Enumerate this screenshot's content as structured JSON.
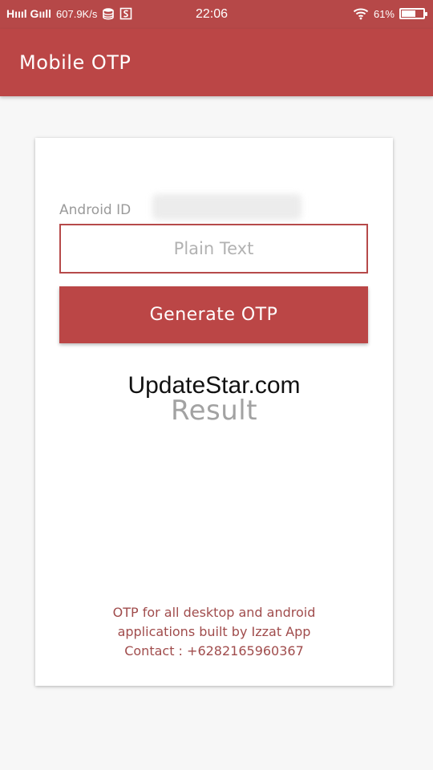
{
  "status_bar": {
    "signal": "Hıııl Gııll",
    "net_speed": "607.9K/s",
    "time": "22:06",
    "battery_percent": "61%",
    "battery_level": 0.61,
    "icons": [
      "database-icon",
      "s-app-icon",
      "wifi-icon",
      "battery-icon"
    ]
  },
  "app_bar": {
    "title": "Mobile OTP"
  },
  "card": {
    "android_id_label": "Android ID",
    "input": {
      "value": "",
      "placeholder": "Plain Text"
    },
    "generate_label": "Generate OTP",
    "result_text": "Result",
    "watermark": "UpdateStar.com",
    "footer": {
      "line1": "OTP for all desktop and android",
      "line2": "applications built by Izzat App",
      "line3": "Contact : +6282165960367"
    }
  },
  "colors": {
    "brand": "#bb4646",
    "status_bar": "#b64848",
    "footer_text": "#a04c4c",
    "background": "#f7f7f7"
  }
}
